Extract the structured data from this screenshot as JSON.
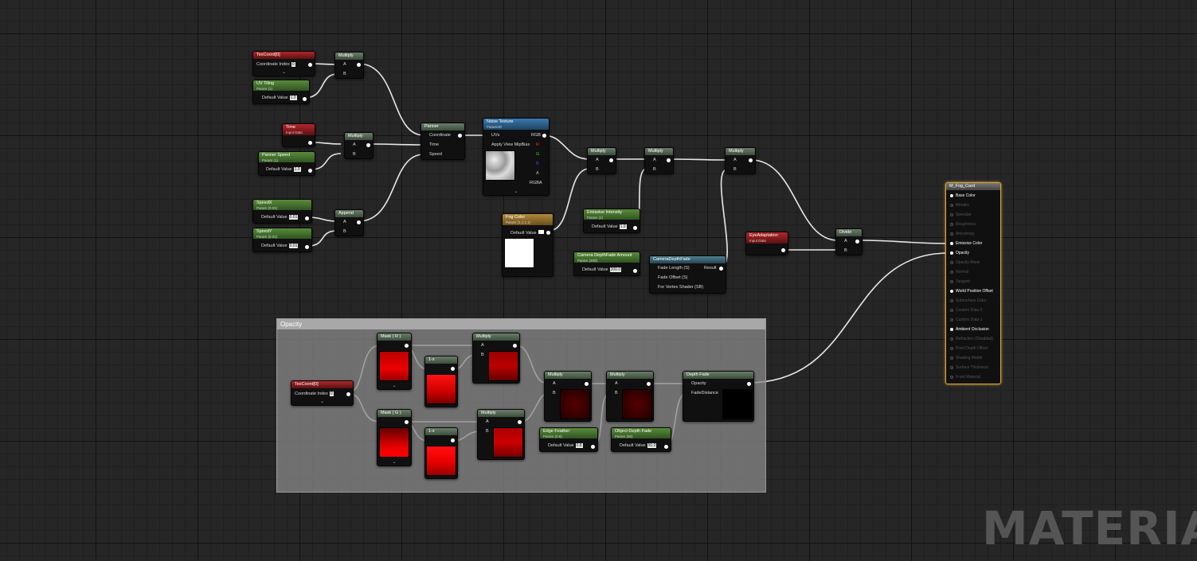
{
  "graph": {
    "comment_title": "Opacity",
    "watermark": "MATERIAL",
    "nodes": {
      "texcoord_top": {
        "title": "TexCoord[0]",
        "coord_label": "Coordinate Index",
        "coord_value": "0"
      },
      "multiply_1": {
        "title": "Multiply",
        "a": "A",
        "b": "B"
      },
      "uv_tiling": {
        "title": "UV Tiling",
        "sub": "Param (1)",
        "label": "Default Value",
        "value": "1.0"
      },
      "time": {
        "title": "Time",
        "sub": "Input Data"
      },
      "multiply_2": {
        "title": "Multiply",
        "a": "A",
        "b": "B"
      },
      "panner_speed": {
        "title": "Panner Speed",
        "sub": "Param (1)",
        "label": "Default Value",
        "value": "1.0"
      },
      "speed_x": {
        "title": "SpeedX",
        "sub": "Param (0.01)",
        "label": "Default Value",
        "value": "0.01"
      },
      "speed_y": {
        "title": "SpeedY",
        "sub": "Param (0.01)",
        "label": "Default Value",
        "value": "0.01"
      },
      "append": {
        "title": "Append",
        "a": "A",
        "b": "B"
      },
      "panner": {
        "title": "Panner",
        "coord": "Coordinate",
        "time": "Time",
        "speed": "Speed"
      },
      "noise_texture": {
        "title": "Noise Texture",
        "sub": "Param2D",
        "uvs": "UVs",
        "mip": "Apply View MipBias",
        "rgb": "RGB",
        "r": "R",
        "g": "G",
        "b": "B",
        "a": "A",
        "rgba": "RGBA"
      },
      "fog_color": {
        "title": "Fog Color",
        "sub": "Param (1,1,1,1)",
        "label": "Default Value"
      },
      "multiply_3": {
        "title": "Multiply",
        "a": "A",
        "b": "B"
      },
      "multiply_4": {
        "title": "Multiply",
        "a": "A",
        "b": "B"
      },
      "emissive_intensity": {
        "title": "Emissive Intensity",
        "sub": "Param (1)",
        "label": "Default Value",
        "value": "1.0"
      },
      "multiply_5": {
        "title": "Multiply",
        "a": "A",
        "b": "B"
      },
      "camera_fade_amount": {
        "title": "Camera DepthFade Amount",
        "sub": "Param (200)",
        "label": "Default Value",
        "value": "200.0"
      },
      "camera_depth_fade": {
        "title": "CameraDepthFade",
        "p1": "Fade Length (S)",
        "p2": "Fade Offset (S)",
        "p3": "For Vertex Shader (SB)",
        "result": "Result"
      },
      "eye_adaptation": {
        "title": "EyeAdaptation",
        "sub": "Input Data"
      },
      "divide": {
        "title": "Divide",
        "a": "A",
        "b": "B"
      },
      "texcoord_bottom": {
        "title": "TexCoord[0]",
        "coord_label": "Coordinate Index",
        "coord_value": "0"
      },
      "mask_r": {
        "title": "Mask ( R )"
      },
      "mask_g": {
        "title": "Mask ( G )"
      },
      "oneminus_1": {
        "title": "1-x"
      },
      "oneminus_2": {
        "title": "1-x"
      },
      "multiply_6": {
        "title": "Multiply",
        "a": "A",
        "b": "B"
      },
      "multiply_7": {
        "title": "Multiply",
        "a": "A",
        "b": "B"
      },
      "multiply_8": {
        "title": "Multiply",
        "a": "A",
        "b": "B"
      },
      "multiply_9": {
        "title": "Multiply",
        "a": "A",
        "b": "B"
      },
      "edge_feather": {
        "title": "Edge Feather",
        "sub": "Param (0.8)",
        "label": "Default Value",
        "value": "0.8"
      },
      "object_depth_fade": {
        "title": "Object Depth Fade",
        "sub": "Param (50)",
        "label": "Default Value",
        "value": "50.0"
      },
      "depth_fade": {
        "title": "Depth Fade",
        "p1": "Opacity",
        "p2": "FadeDistance"
      }
    },
    "result_node": {
      "title": "M_Fog_Card",
      "pins": [
        {
          "label": "Base Color",
          "active": true
        },
        {
          "label": "Metallic",
          "active": false
        },
        {
          "label": "Specular",
          "active": false
        },
        {
          "label": "Roughness",
          "active": false
        },
        {
          "label": "Anisotropy",
          "active": false
        },
        {
          "label": "Emissive Color",
          "active": true
        },
        {
          "label": "Opacity",
          "active": true
        },
        {
          "label": "Opacity Mask",
          "active": false
        },
        {
          "label": "Normal",
          "active": false
        },
        {
          "label": "Tangent",
          "active": false
        },
        {
          "label": "World Position Offset",
          "active": true
        },
        {
          "label": "Subsurface Color",
          "active": false
        },
        {
          "label": "Custom Data 0",
          "active": false
        },
        {
          "label": "Custom Data 1",
          "active": false
        },
        {
          "label": "Ambient Occlusion",
          "active": true
        },
        {
          "label": "Refraction (Disabled)",
          "active": false
        },
        {
          "label": "Pixel Depth Offset",
          "active": false
        },
        {
          "label": "Shading Model",
          "active": false
        },
        {
          "label": "Surface Thickness",
          "active": false
        },
        {
          "label": "Front Material",
          "active": false
        }
      ]
    }
  }
}
